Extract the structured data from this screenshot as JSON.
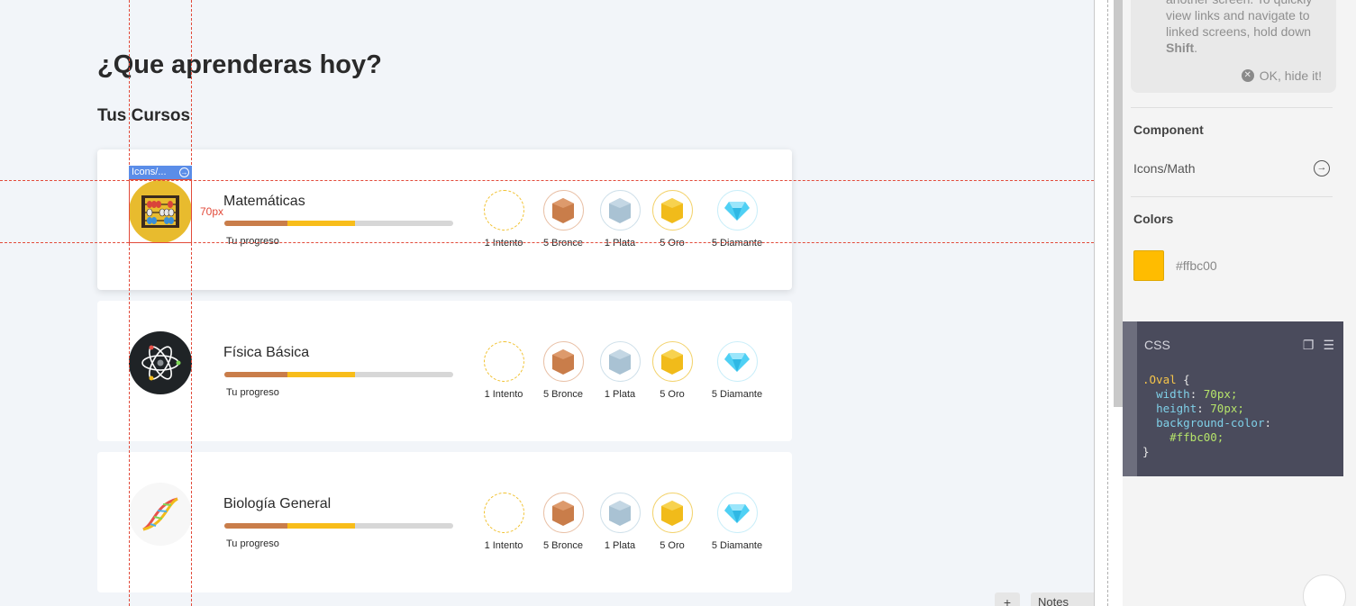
{
  "page": {
    "title": "¿Que aprenderas hoy?",
    "section_title": "Tus Cursos"
  },
  "courses": [
    {
      "name": "Matemáticas",
      "progress_label": "Tu progreso",
      "icon": "abacus-icon",
      "icon_bg": "#e8bb2e",
      "medals": [
        "1 Intento",
        "5 Bronce",
        "1 Plata",
        "5 Oro",
        "5 Diamante"
      ]
    },
    {
      "name": "Física Básica",
      "progress_label": "Tu progreso",
      "icon": "atom-icon",
      "icon_bg": "#1f2326",
      "medals": [
        "1 Intento",
        "5 Bronce",
        "1 Plata",
        "5 Oro",
        "5 Diamante"
      ]
    },
    {
      "name": "Biología General",
      "progress_label": "Tu progreso",
      "icon": "dna-icon",
      "icon_bg": "#f7f7f7",
      "medals": [
        "1 Intento",
        "5 Bronce",
        "1 Plata",
        "5 Oro",
        "5 Diamante"
      ]
    }
  ],
  "inspector": {
    "selection_tag": "Icons/...",
    "width_label": "70px",
    "height_label": "70px"
  },
  "panel": {
    "tip_text_1": "another screen. To quickly view links and navigate to linked screens, hold down ",
    "tip_text_bold": "Shift",
    "tip_text_2": ".",
    "tip_hide": "OK, hide it!",
    "component_heading": "Component",
    "component_name": "Icons/Math",
    "colors_heading": "Colors",
    "color_hex": "#ffbc00",
    "css_heading": "CSS",
    "css_selector": ".Oval",
    "css_width": "70px;",
    "css_height": "70px;",
    "css_bg": "#ffbc00;"
  },
  "footer": {
    "notes_label": "Notes",
    "plus_label": "+"
  },
  "colors": {
    "bronze": "#c97d4a",
    "silver": "#a9c2d3",
    "gold": "#f1bb1a",
    "diamond": "#4fd0f4",
    "accent": "#ffbc00"
  }
}
